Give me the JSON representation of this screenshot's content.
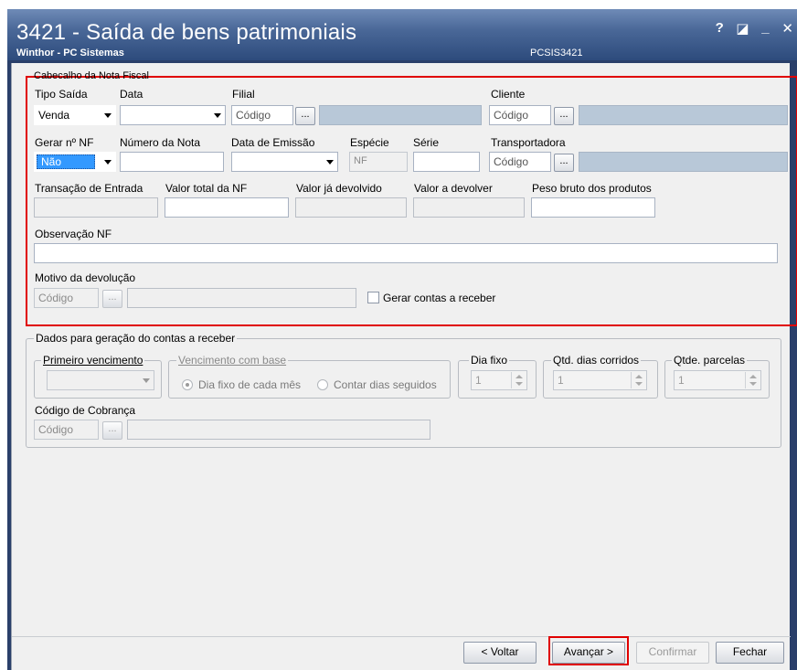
{
  "window": {
    "title": "3421 - Saída de bens patrimoniais",
    "subtitle": "Winthor - PC Sistemas",
    "code": "PCSIS3421",
    "btn_help": "?",
    "btn_restore": "◪",
    "btn_minimize": "_",
    "btn_close": "✕"
  },
  "cabecalho": {
    "group_title": "Cabeçalho da Nota Fiscal",
    "tipo_saida": {
      "label": "Tipo Saída",
      "value": "Venda"
    },
    "data": {
      "label": "Data",
      "value": ""
    },
    "filial": {
      "label": "Filial",
      "placeholder": "Código",
      "ellipsis": "..."
    },
    "cliente": {
      "label": "Cliente",
      "placeholder": "Código",
      "ellipsis": "..."
    },
    "gerar_nf": {
      "label": "Gerar nº NF",
      "value": "Não"
    },
    "numero_nota": {
      "label": "Número da Nota",
      "value": ""
    },
    "data_emissao": {
      "label": "Data de Emissão",
      "value": ""
    },
    "especie": {
      "label": "Espécie",
      "value": "NF"
    },
    "serie": {
      "label": "Série",
      "value": ""
    },
    "transportadora": {
      "label": "Transportadora",
      "placeholder": "Código",
      "ellipsis": "..."
    },
    "transacao_entrada": {
      "label": "Transação de Entrada"
    },
    "valor_total_nf": {
      "label": "Valor total da NF"
    },
    "valor_devolvido": {
      "label": "Valor já devolvido"
    },
    "valor_devolver": {
      "label": "Valor a devolver"
    },
    "peso_bruto": {
      "label": "Peso bruto dos produtos"
    },
    "observacao": {
      "label": "Observação NF"
    },
    "motivo": {
      "label": "Motivo da devolução",
      "placeholder": "Código",
      "ellipsis": "..."
    },
    "gerar_contas": {
      "label": "Gerar contas a receber"
    }
  },
  "contas": {
    "group_title": "Dados para geração do contas a receber",
    "primeiro_vencimento": {
      "label": "Primeiro vencimento"
    },
    "vencimento_base": {
      "label": "Vencimento com base",
      "opt1": "Dia fixo de cada mês",
      "opt2": "Contar dias seguidos"
    },
    "dia_fixo": {
      "label": "Dia fixo",
      "value": "1"
    },
    "qtd_dias": {
      "label": "Qtd. dias corridos",
      "value": "1"
    },
    "qtde_parcelas": {
      "label": "Qtde. parcelas",
      "value": "1"
    },
    "codigo_cobranca": {
      "label": "Código de Cobrança",
      "placeholder": "Código",
      "ellipsis": "..."
    }
  },
  "footer": {
    "voltar": "< Voltar",
    "avancar": "Avançar >",
    "confirmar": "Confirmar",
    "fechar": "Fechar"
  },
  "colors": {
    "highlight_red": "#e00000",
    "title_bar": "#4a6898",
    "readonly_field": "#b8c8d8"
  }
}
